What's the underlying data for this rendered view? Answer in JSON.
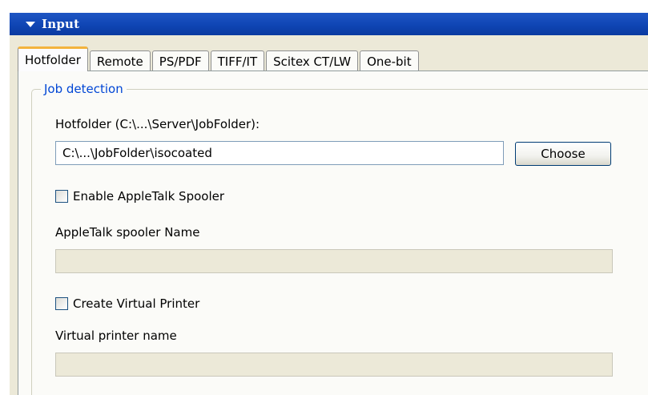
{
  "panel": {
    "title": "Input"
  },
  "tabs": [
    {
      "label": "Hotfolder",
      "active": true
    },
    {
      "label": "Remote",
      "active": false
    },
    {
      "label": "PS/PDF",
      "active": false
    },
    {
      "label": "TIFF/IT",
      "active": false
    },
    {
      "label": "Scitex CT/LW",
      "active": false
    },
    {
      "label": "One-bit",
      "active": false
    }
  ],
  "job_detection": {
    "legend": "Job detection",
    "hotfolder_label": "Hotfolder (C:\\...\\Server\\JobFolder):",
    "hotfolder_value": "C:\\...\\JobFolder\\isocoated",
    "choose_label": "Choose",
    "appletalk_checkbox_label": "Enable AppleTalk Spooler",
    "appletalk_checked": false,
    "appletalk_name_label": "AppleTalk spooler Name",
    "appletalk_name_value": "",
    "virtual_printer_checkbox_label": "Create Virtual Printer",
    "virtual_printer_checked": false,
    "virtual_printer_name_label": "Virtual printer name",
    "virtual_printer_name_value": ""
  },
  "colors": {
    "title_bar": "#0f45b4",
    "active_tab_accent": "#f3b33d",
    "legend_text": "#0046d5",
    "panel_background": "#ece9d8"
  },
  "icons": {
    "collapse": "triangle-down-icon"
  }
}
